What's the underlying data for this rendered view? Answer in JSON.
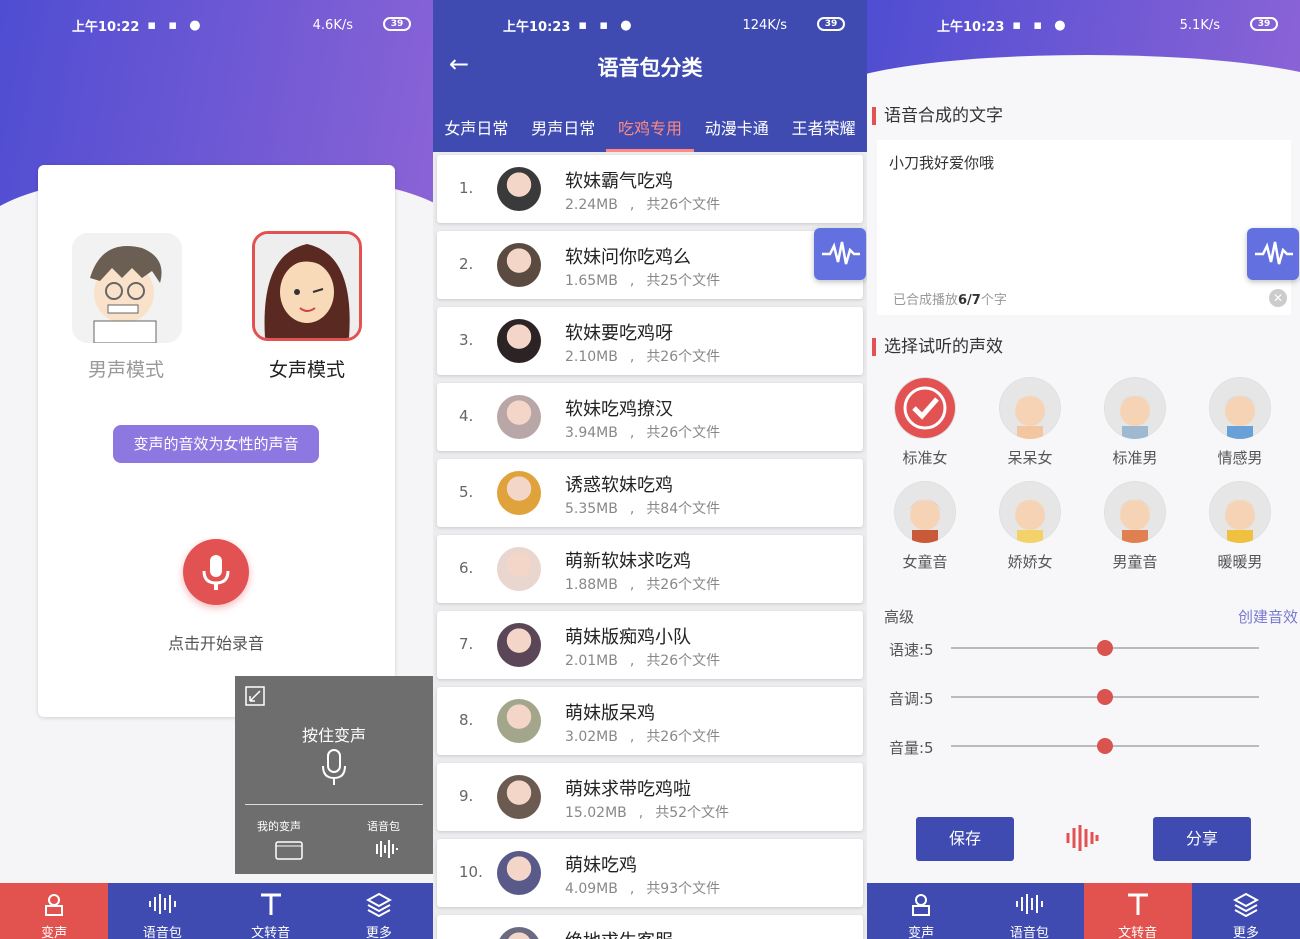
{
  "panel1": {
    "status": {
      "time": "上午10:22",
      "net": "4.6K/s",
      "battery": "39"
    },
    "male_mode": "男声模式",
    "female_mode": "女声模式",
    "effect_pill": "变声的音效为女性的声音",
    "record_label": "点击开始录音",
    "float": {
      "hold": "按住变声",
      "my_voice": "我的变声",
      "voice_pack": "语音包"
    },
    "nav": [
      "变声",
      "语音包",
      "文转音",
      "更多"
    ]
  },
  "panel2": {
    "status": {
      "time": "上午10:23",
      "net": "124K/s",
      "battery": "39"
    },
    "title": "语音包分类",
    "tabs": [
      "女声日常",
      "男声日常",
      "吃鸡专用",
      "动漫卡通",
      "王者荣耀"
    ],
    "active_tab": 2,
    "rows": [
      {
        "num": "1.",
        "name": "软妹霸气吃鸡",
        "size": "2.24MB",
        "files": "共26个文件",
        "color": "#3a3a3a"
      },
      {
        "num": "2.",
        "name": "软妹问你吃鸡么",
        "size": "1.65MB",
        "files": "共25个文件",
        "color": "#5b4a40"
      },
      {
        "num": "3.",
        "name": "软妹要吃鸡呀",
        "size": "2.10MB",
        "files": "共26个文件",
        "color": "#2c2424"
      },
      {
        "num": "4.",
        "name": "软妹吃鸡撩汉",
        "size": "3.94MB",
        "files": "共26个文件",
        "color": "#b9a6a6"
      },
      {
        "num": "5.",
        "name": "诱惑软妹吃鸡",
        "size": "5.35MB",
        "files": "共84个文件",
        "color": "#e0a23a"
      },
      {
        "num": "6.",
        "name": "萌新软妹求吃鸡",
        "size": "1.88MB",
        "files": "共26个文件",
        "color": "#e8d6cf"
      },
      {
        "num": "7.",
        "name": "萌妹版痴鸡小队",
        "size": "2.01MB",
        "files": "共26个文件",
        "color": "#5a4656"
      },
      {
        "num": "8.",
        "name": "萌妹版呆鸡",
        "size": "3.02MB",
        "files": "共26个文件",
        "color": "#a3a68a"
      },
      {
        "num": "9.",
        "name": "萌妹求带吃鸡啦",
        "size": "15.02MB",
        "files": "共52个文件",
        "color": "#6b5a50"
      },
      {
        "num": "10.",
        "name": "萌妹吃鸡",
        "size": "4.09MB",
        "files": "共93个文件",
        "color": "#5a5a8a"
      },
      {
        "num": "",
        "name": "绝地求生客服",
        "size": "",
        "files": "",
        "color": "#6a6a80"
      }
    ]
  },
  "panel3": {
    "status": {
      "time": "上午10:23",
      "net": "5.1K/s",
      "battery": "39"
    },
    "sec_text": "语音合成的文字",
    "input_text": "小刀我好爱你哦",
    "progress_prefix": "已合成播放",
    "progress_value": "6/7",
    "progress_suffix": "个字",
    "sec_voice": "选择试听的声效",
    "voices": [
      "标准女",
      "呆呆女",
      "标准男",
      "情感男",
      "女童音",
      "娇娇女",
      "男童音",
      "暖暖男"
    ],
    "selected_voice": 0,
    "advanced": "高级",
    "create": "创建音效",
    "sliders": [
      {
        "label": "语速:5",
        "value": 0.5
      },
      {
        "label": "音调:5",
        "value": 0.5
      },
      {
        "label": "音量:5",
        "value": 0.5
      }
    ],
    "save": "保存",
    "share": "分享",
    "nav": [
      "变声",
      "语音包",
      "文转音",
      "更多"
    ]
  }
}
